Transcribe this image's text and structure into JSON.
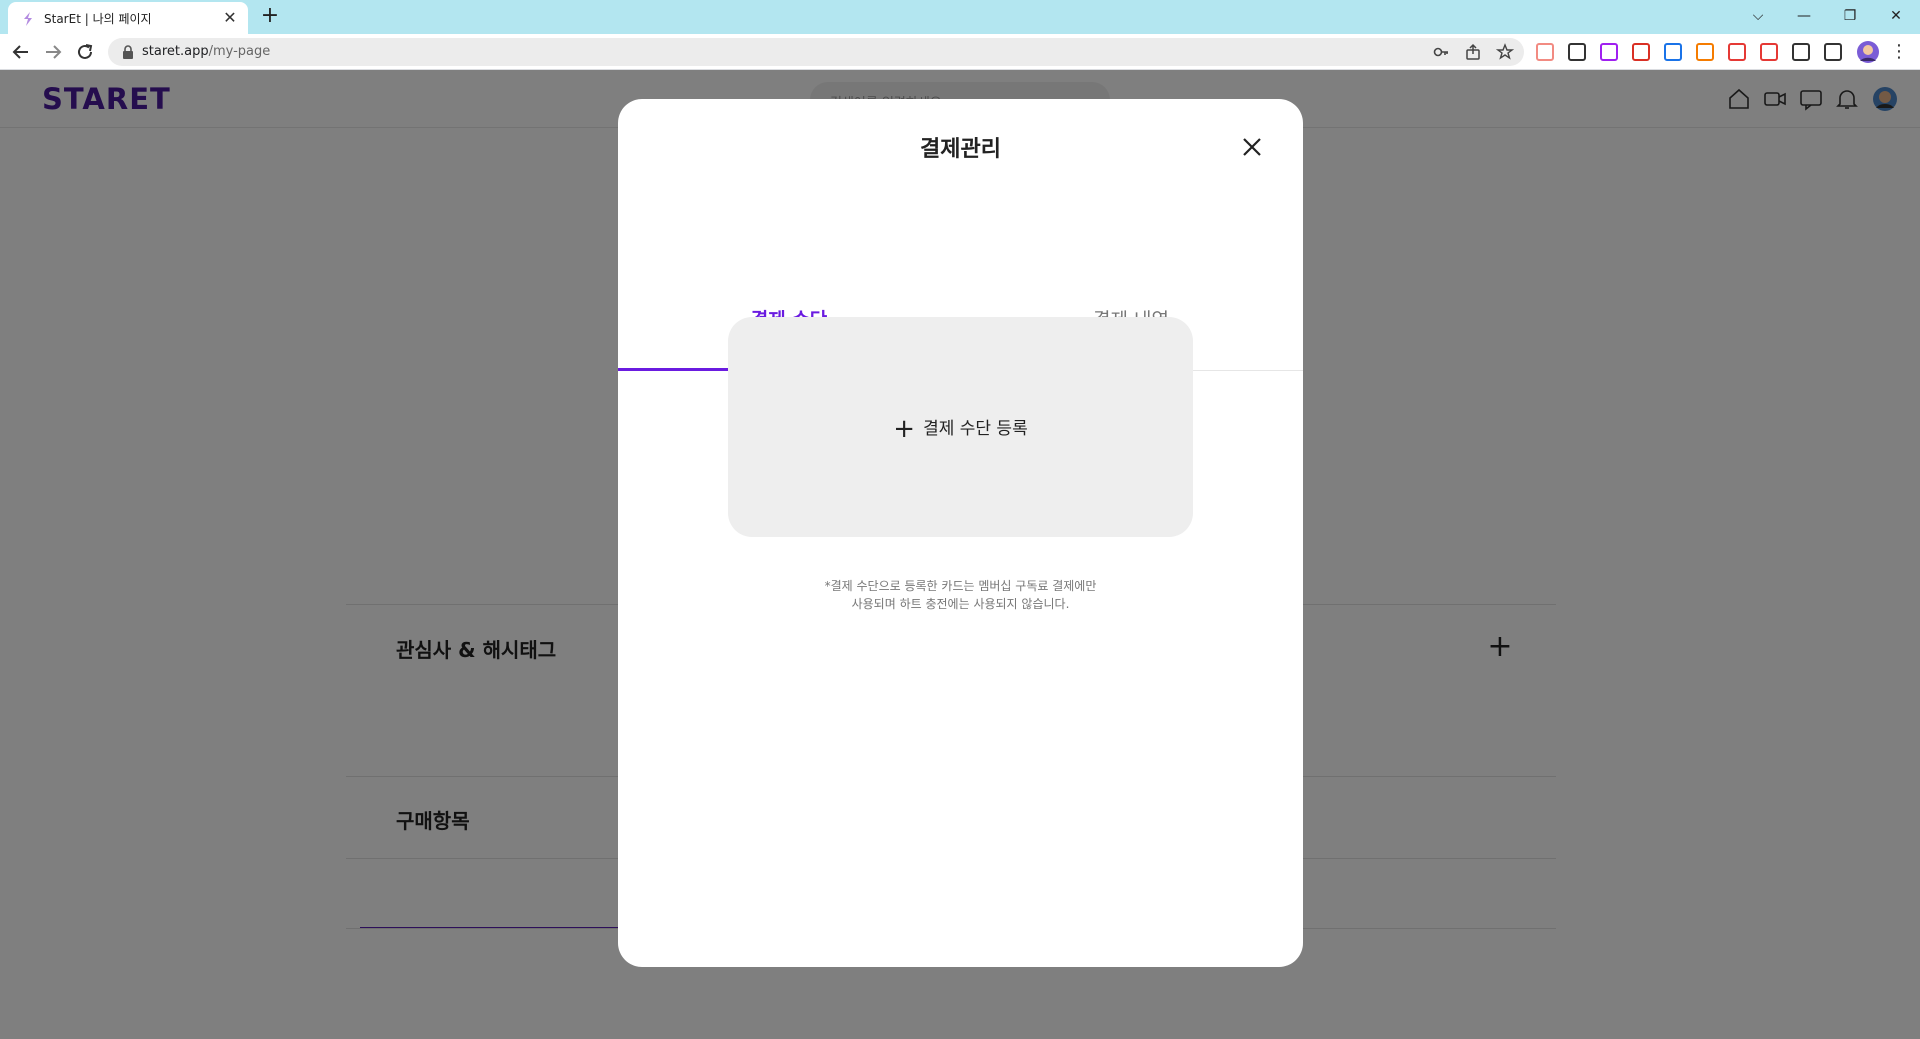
{
  "browser": {
    "tab_title": "StarEt | 나의 페이지",
    "url_host": "staret.app",
    "url_path": "/my-page",
    "window_controls": {
      "tab_search": "⌵",
      "minimize": "—",
      "restore": "❐",
      "close": "✕"
    },
    "extensions": [
      {
        "name": "cast-icon",
        "color": "#f28b82"
      },
      {
        "name": "notion-icon",
        "color": "#333333"
      },
      {
        "name": "extension-purple-icon",
        "color": "#a020f0"
      },
      {
        "name": "extension-red-icon",
        "color": "#d93025"
      },
      {
        "name": "react-devtools-icon",
        "color": "#1a73e8"
      },
      {
        "name": "extension-ex-icon",
        "color": "#f57c00"
      },
      {
        "name": "extension-arrow-icon",
        "color": "#e53935"
      },
      {
        "name": "extension-code-icon",
        "color": "#e53935"
      },
      {
        "name": "puzzle-icon",
        "color": "#333333"
      },
      {
        "name": "side-panel-icon",
        "color": "#333333"
      }
    ]
  },
  "site": {
    "logo": "STARET",
    "search_placeholder": "검색어를 입력하세요",
    "sections": {
      "interests": "관심사 & 해시태그",
      "purchases": "구매항목"
    },
    "add_symbol": "+"
  },
  "modal": {
    "title": "결제관리",
    "tabs": [
      "결제 수단",
      "결제 내역"
    ],
    "active_tab": 0,
    "add_payment_label": "결제 수단 등록",
    "add_symbol": "+",
    "note_line1": "*결제 수단으로 등록한 카드는 멤버십 구독료 결제에만",
    "note_line2": "사용되며 하트 충전에는 사용되지 않습니다.",
    "accent_color": "#6a1be0"
  }
}
